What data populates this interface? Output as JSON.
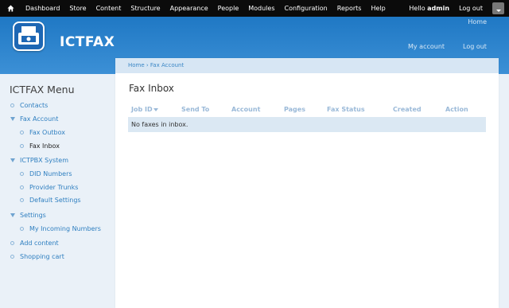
{
  "toolbar": {
    "menu": [
      "Dashboard",
      "Store",
      "Content",
      "Structure",
      "Appearance",
      "People",
      "Modules",
      "Configuration",
      "Reports",
      "Help"
    ],
    "hello_prefix": "Hello ",
    "username": "admin",
    "logout": "Log out"
  },
  "header": {
    "site_name": "ICTFAX",
    "nav_home": "Home",
    "nav_account": "My account",
    "nav_logout": "Log out"
  },
  "sidebar": {
    "title": "ICTFAX Menu",
    "items": [
      {
        "label": "Contacts"
      },
      {
        "label": "Fax Account"
      },
      {
        "label": "Fax Outbox"
      },
      {
        "label": "Fax Inbox"
      },
      {
        "label": "ICTPBX System"
      },
      {
        "label": "DID Numbers"
      },
      {
        "label": "Provider Trunks"
      },
      {
        "label": "Default Settings"
      },
      {
        "label": "Settings"
      },
      {
        "label": "My Incoming Numbers"
      },
      {
        "label": "Add content"
      },
      {
        "label": "Shopping cart"
      }
    ]
  },
  "breadcrumb": "Home › Fax Account",
  "page_title": "Fax Inbox",
  "table": {
    "headers": [
      "Job ID",
      "Send To",
      "Account",
      "Pages",
      "Fax Status",
      "Created",
      "Action"
    ],
    "empty_message": "No faxes in inbox."
  },
  "colors": {
    "toolbar_bg": "#0b0b0b",
    "header_blue": "#2b82cc",
    "link": "#2f7fc0",
    "row_bg": "#dbe8f3"
  }
}
